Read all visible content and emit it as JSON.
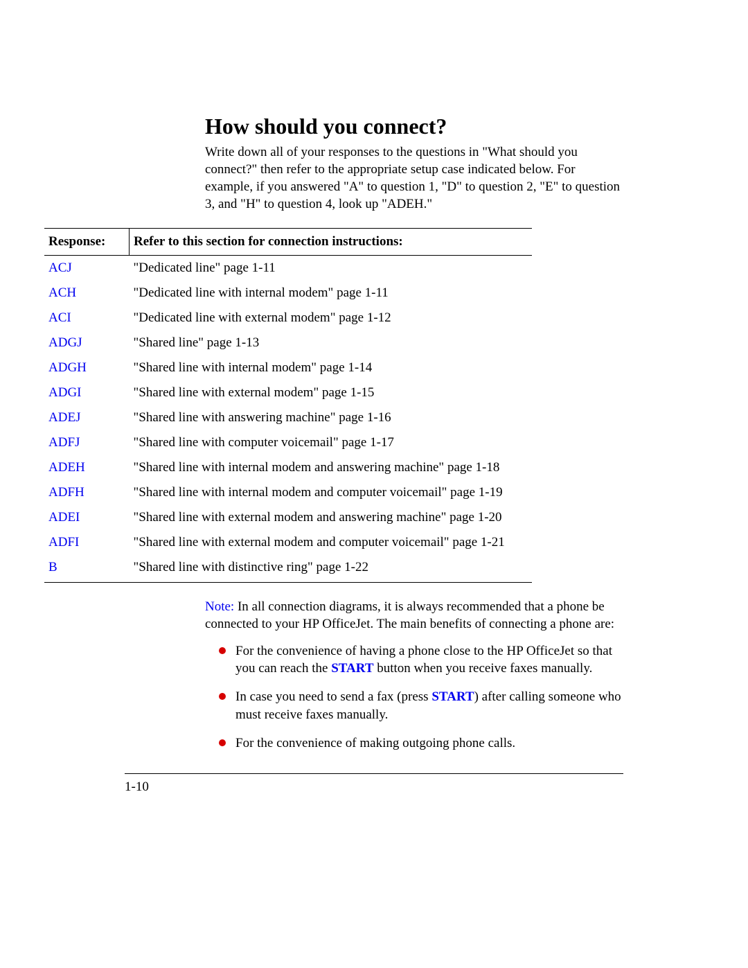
{
  "heading": "How should you connect?",
  "intro": "Write down all of your responses to the questions in \"What should you connect?\" then refer to the appropriate setup case indicated below. For example, if you answered \"A\" to question 1, \"D\" to question 2, \"E\" to question 3, and \"H\" to question 4, look up \"ADEH.\"",
  "table": {
    "header_response": "Response:",
    "header_refer": "Refer to this section for connection instructions:",
    "rows": [
      {
        "code": "ACJ",
        "desc": "\"Dedicated line\" page 1-11"
      },
      {
        "code": "ACH",
        "desc": "\"Dedicated line with internal modem\" page 1-11"
      },
      {
        "code": "ACI",
        "desc": "\"Dedicated line with external modem\" page 1-12"
      },
      {
        "code": "ADGJ",
        "desc": "\"Shared line\" page 1-13"
      },
      {
        "code": "ADGH",
        "desc": "\"Shared line with internal modem\" page 1-14"
      },
      {
        "code": "ADGI",
        "desc": "\"Shared line with external modem\" page 1-15"
      },
      {
        "code": "ADEJ",
        "desc": "\"Shared line with answering machine\" page 1-16"
      },
      {
        "code": "ADFJ",
        "desc": "\"Shared line with computer voicemail\" page 1-17"
      },
      {
        "code": "ADEH",
        "desc": "\"Shared line with internal modem and answering machine\" page 1-18"
      },
      {
        "code": "ADFH",
        "desc": "\"Shared line with internal modem and computer voicemail\" page 1-19"
      },
      {
        "code": "ADEI",
        "desc": "\"Shared line with external modem and answering machine\" page 1-20"
      },
      {
        "code": "ADFI",
        "desc": "\"Shared line with external modem and computer voicemail\" page 1-21"
      },
      {
        "code": "B",
        "desc": "\"Shared line with distinctive ring\" page 1-22"
      }
    ]
  },
  "note": {
    "prefix": "Note:",
    "text": " In all connection diagrams, it is always recommended that a phone be connected to your HP OfficeJet. The main benefits of connecting a phone are:"
  },
  "bullets": {
    "b1_pre": "For the convenience of having a phone close to the HP OfficeJet so that you can reach the ",
    "b1_start": "START",
    "b1_post": " button when you receive faxes manually.",
    "b2_pre": "In case you need to send a fax (press ",
    "b2_start": "START",
    "b2_post": ") after calling someone who must receive faxes manually.",
    "b3": "For the convenience of making outgoing phone calls."
  },
  "page_number": "1-10"
}
